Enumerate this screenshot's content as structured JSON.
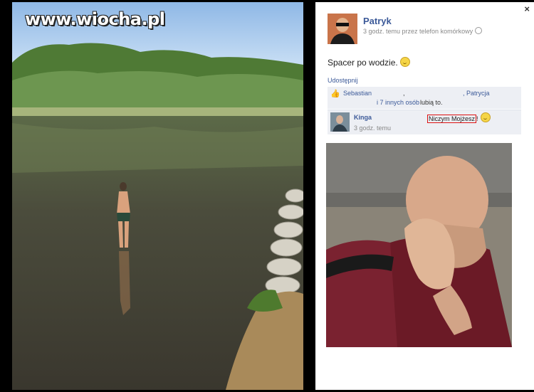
{
  "watermark": "www.wiocha.pl",
  "post": {
    "close_icon": "×",
    "author": "Patryk",
    "meta": "3 godz. temu przez telefon komórkowy",
    "status": "Spacer po wodzie.",
    "share": "Udostępnij",
    "likes": {
      "name1": "Sebastian",
      "comma": ",",
      "name2": ", Patrycja",
      "others": "i 7 innych osób",
      "tail": "lubią to."
    },
    "comment": {
      "author": "Kinga",
      "text": "Niczym Mojżesz",
      "suffix": "!",
      "time": "3 godz. temu"
    }
  },
  "colors": {
    "link": "#3b5998",
    "likes_bg": "#edeff4",
    "highlight": "#dd1111"
  }
}
